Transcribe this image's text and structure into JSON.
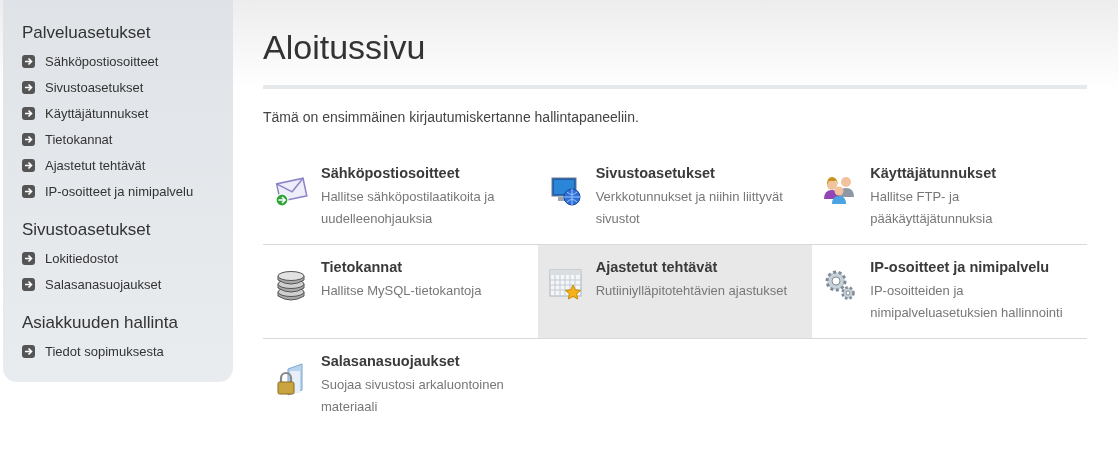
{
  "sidebar": {
    "sections": [
      {
        "title": "Palveluasetukset",
        "items": [
          "Sähköpostiosoitteet",
          "Sivustoasetukset",
          "Käyttäjätunnukset",
          "Tietokannat",
          "Ajastetut tehtävät",
          "IP-osoitteet ja nimipalvelu"
        ]
      },
      {
        "title": "Sivustoasetukset",
        "items": [
          "Lokitiedostot",
          "Salasanasuojaukset"
        ]
      },
      {
        "title": "Asiakkuuden hallinta",
        "items": [
          "Tiedot sopimuksesta"
        ]
      }
    ]
  },
  "main": {
    "title": "Aloitussivu",
    "intro": "Tämä on ensimmäinen kirjautumiskertanne hallintapaneeliin.",
    "tiles": [
      {
        "kind": "email",
        "title": "Sähköpostiosoitteet",
        "description": "Hallitse sähköpostilaatikoita ja uudelleenohjauksia",
        "selected": false
      },
      {
        "kind": "site",
        "title": "Sivustoasetukset",
        "description": "Verkkotunnukset ja niihin liittyvät sivustot",
        "selected": false
      },
      {
        "kind": "users",
        "title": "Käyttäjätunnukset",
        "description": "Hallitse FTP- ja pääkäyttäjätunnuksia",
        "selected": false
      },
      {
        "kind": "database",
        "title": "Tietokannat",
        "description": "Hallitse MySQL-tietokantoja",
        "selected": false
      },
      {
        "kind": "calendar",
        "title": "Ajastetut tehtävät",
        "description": "Rutiiniylläpitotehtävien ajastukset",
        "selected": true
      },
      {
        "kind": "gears",
        "title": "IP-osoitteet ja nimipalvelu",
        "description": "IP-osoitteiden ja nimipalveluasetuksien hallinnointi",
        "selected": false
      },
      {
        "kind": "lock",
        "title": "Salasanasuojaukset",
        "description": "Suojaa sivustosi arkaluontoinen materiaali",
        "selected": false
      }
    ]
  }
}
